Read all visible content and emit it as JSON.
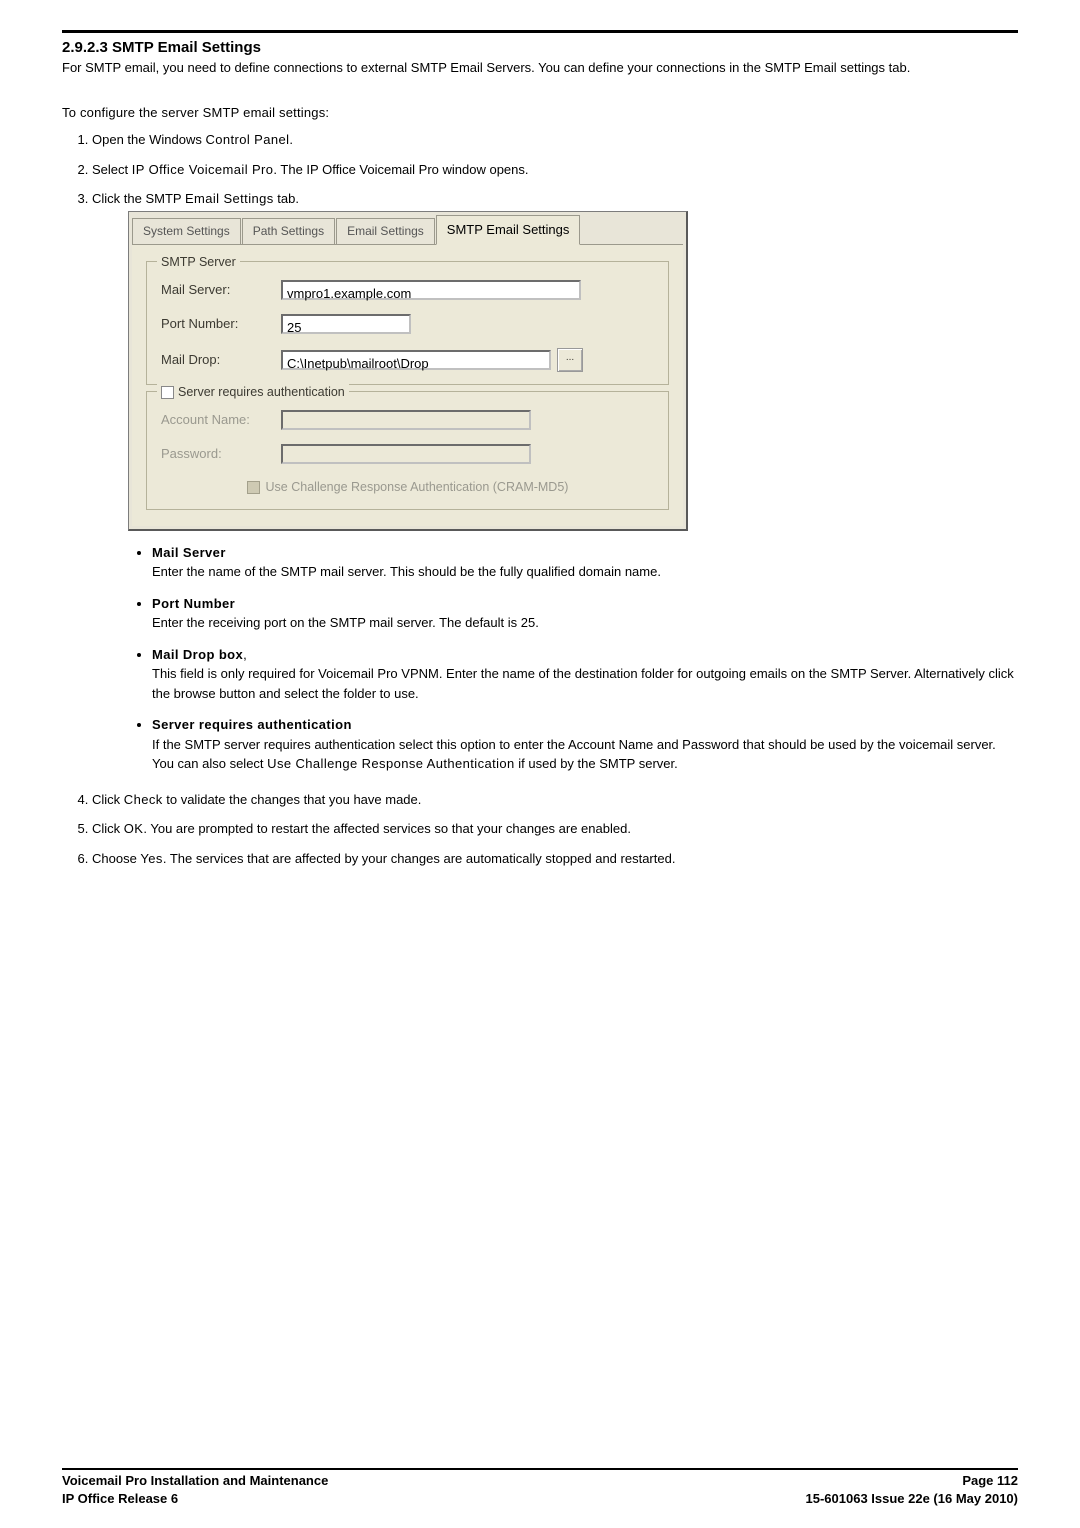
{
  "section_number": "2.9.2.3 SMTP Email Settings",
  "intro": "For SMTP email, you need to define connections to external SMTP Email Servers. You can define your connections in the SMTP Email settings tab.",
  "configure_heading": "To configure the server SMTP email settings:",
  "step1_pre": "Open the Windows ",
  "step1_bold": "Control Panel",
  "step1_post": ".",
  "step2_pre": "Select ",
  "step2_bold": "IP Office Voicemail Pro",
  "step2_post": ". The IP Office Voicemail Pro window opens.",
  "step3_pre": "Click the SMTP ",
  "step3_bold": "Email Settings",
  "step3_post": " tab.",
  "dialog": {
    "tabs": [
      "System Settings",
      "Path Settings",
      "Email Settings",
      "SMTP Email Settings"
    ],
    "smtp_server_legend": "SMTP Server",
    "labels": {
      "mail_server": "Mail Server:",
      "port_number": "Port Number:",
      "mail_drop": "Mail Drop:",
      "account_name": "Account Name:",
      "password": "Password:"
    },
    "values": {
      "mail_server": "vmpro1.example.com",
      "port_number": "25",
      "mail_drop": "C:\\Inetpub\\mailroot\\Drop"
    },
    "browse_label": "...",
    "auth_legend": "Server requires authentication",
    "cram_label": "Use Challenge Response Authentication (CRAM-MD5)"
  },
  "bullets": {
    "mail_server_title": "Mail Server",
    "mail_server_text": "Enter the name of the SMTP mail server. This should be the fully qualified domain name.",
    "port_title": "Port Number",
    "port_text": "Enter the receiving port on the SMTP mail server. The default is 25.",
    "maildrop_title": "Mail Drop box",
    "maildrop_comma": ",",
    "maildrop_text": "This field is only required for Voicemail Pro VPNM. Enter the name of the destination folder for outgoing emails on the SMTP Server. Alternatively click the browse button and select the folder to use.",
    "auth_title": "Server requires authentication",
    "auth_text_1": "If the SMTP server requires authentication select this option to enter the Account Name and Password that should be used by the voicemail server. You can also select ",
    "auth_text_bold": "Use Challenge Response Authentication",
    "auth_text_2": " if used by the SMTP server."
  },
  "step4_pre": "Click ",
  "step4_bold": "Check",
  "step4_post": " to validate the changes that you have made.",
  "step5_pre": "Click ",
  "step5_bold": "OK",
  "step5_post": ". You are prompted to restart the affected services so that your changes are enabled.",
  "step6_pre": "Choose ",
  "step6_bold": "Yes",
  "step6_post": ". The services that are affected by your changes are automatically stopped and restarted.",
  "footer": {
    "left1": "Voicemail Pro Installation and Maintenance",
    "left2": "IP Office Release 6",
    "right1": "Page 112",
    "right2": "15-601063 Issue 22e (16 May 2010)"
  }
}
